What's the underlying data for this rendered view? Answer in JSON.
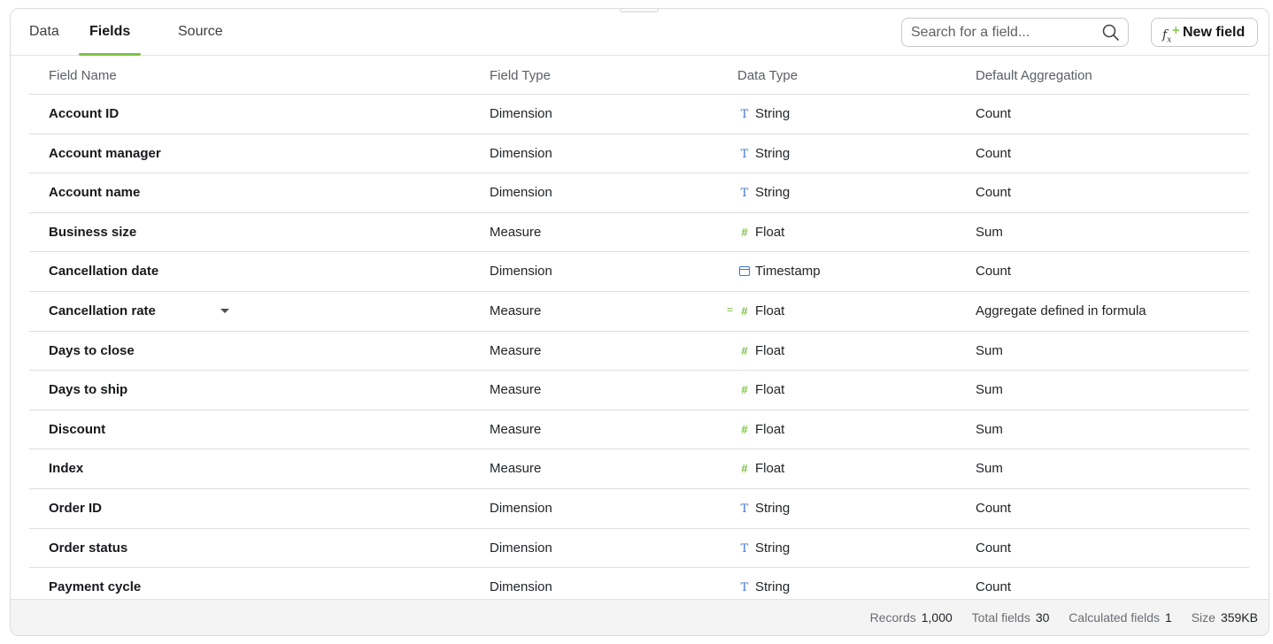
{
  "tabs": [
    {
      "label": "Data",
      "active": false
    },
    {
      "label": "Fields",
      "active": true
    },
    {
      "label": "Source",
      "active": false
    }
  ],
  "search": {
    "placeholder": "Search for a field...",
    "icon": "search-icon"
  },
  "new_field": {
    "label": "New field",
    "icon": "fx-icon"
  },
  "colors": {
    "accent": "#7cc242",
    "string_icon": "#3b73d9"
  },
  "columns": [
    "Field Name",
    "Field Type",
    "Data Type",
    "Default Aggregation"
  ],
  "rows": [
    {
      "name": "Account ID",
      "field_type": "Dimension",
      "data_type": "String",
      "type_icon": "string",
      "agg": "Count"
    },
    {
      "name": "Account manager",
      "field_type": "Dimension",
      "data_type": "String",
      "type_icon": "string",
      "agg": "Count"
    },
    {
      "name": "Account name",
      "field_type": "Dimension",
      "data_type": "String",
      "type_icon": "string",
      "agg": "Count"
    },
    {
      "name": "Business size",
      "field_type": "Measure",
      "data_type": "Float",
      "type_icon": "float",
      "agg": "Sum"
    },
    {
      "name": "Cancellation date",
      "field_type": "Dimension",
      "data_type": "Timestamp",
      "type_icon": "timestamp",
      "agg": "Count"
    },
    {
      "name": "Cancellation rate",
      "field_type": "Measure",
      "data_type": "Float",
      "type_icon": "float",
      "calculated": true,
      "agg": "Aggregate defined in formula"
    },
    {
      "name": "Days to close",
      "field_type": "Measure",
      "data_type": "Float",
      "type_icon": "float",
      "agg": "Sum"
    },
    {
      "name": "Days to ship",
      "field_type": "Measure",
      "data_type": "Float",
      "type_icon": "float",
      "agg": "Sum"
    },
    {
      "name": "Discount",
      "field_type": "Measure",
      "data_type": "Float",
      "type_icon": "float",
      "agg": "Sum"
    },
    {
      "name": "Index",
      "field_type": "Measure",
      "data_type": "Float",
      "type_icon": "float",
      "agg": "Sum"
    },
    {
      "name": "Order ID",
      "field_type": "Dimension",
      "data_type": "String",
      "type_icon": "string",
      "agg": "Count"
    },
    {
      "name": "Order status",
      "field_type": "Dimension",
      "data_type": "String",
      "type_icon": "string",
      "agg": "Count"
    },
    {
      "name": "Payment cycle",
      "field_type": "Dimension",
      "data_type": "String",
      "type_icon": "string",
      "agg": "Count"
    }
  ],
  "footer": {
    "records_label": "Records",
    "records_value": "1,000",
    "total_label": "Total fields",
    "total_value": "30",
    "calc_label": "Calculated fields",
    "calc_value": "1",
    "size_label": "Size",
    "size_value": "359KB"
  }
}
